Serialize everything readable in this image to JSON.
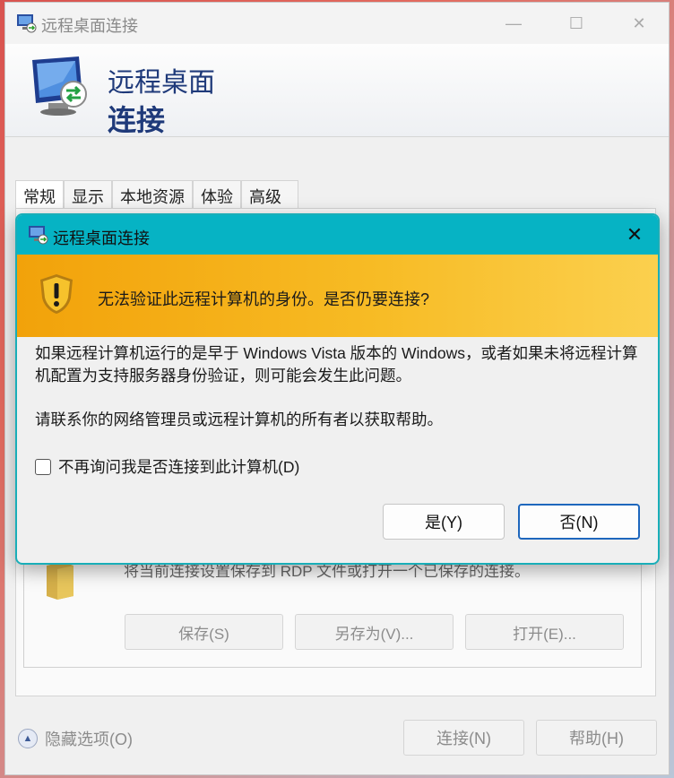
{
  "window": {
    "title": "远程桌面连接",
    "banner_line1": "远程桌面",
    "banner_line2": "连接",
    "tabs": [
      {
        "label": "常规"
      },
      {
        "label": "显示"
      },
      {
        "label": "本地资源"
      },
      {
        "label": "体验"
      },
      {
        "label": "高级"
      }
    ],
    "save_group": {
      "description": "将当前连接设置保存到 RDP 文件或打开一个已保存的连接。",
      "save_label": "保存(S)",
      "saveas_label": "另存为(V)...",
      "open_label": "打开(E)..."
    },
    "hide_options_label": "隐藏选项(O)",
    "connect_label": "连接(N)",
    "help_label": "帮助(H)"
  },
  "dialog": {
    "title": "远程桌面连接",
    "headline": "无法验证此远程计算机的身份。是否仍要连接?",
    "paragraph1": "如果远程计算机运行的是早于 Windows Vista 版本的 Windows，或者如果未将远程计算机配置为支持服务器身份验证，则可能会发生此问题。",
    "paragraph2": "请联系你的网络管理员或远程计算机的所有者以获取帮助。",
    "checkbox_label": "不再询问我是否连接到此计算机(D)",
    "checkbox_checked": false,
    "yes_label": "是(Y)",
    "no_label": "否(N)"
  },
  "colors": {
    "dialog_titlebar": "#06b3c4",
    "warning_banner": "#f7bb24",
    "banner_text": "#1f3a7a",
    "focus_border": "#1e67bd"
  }
}
